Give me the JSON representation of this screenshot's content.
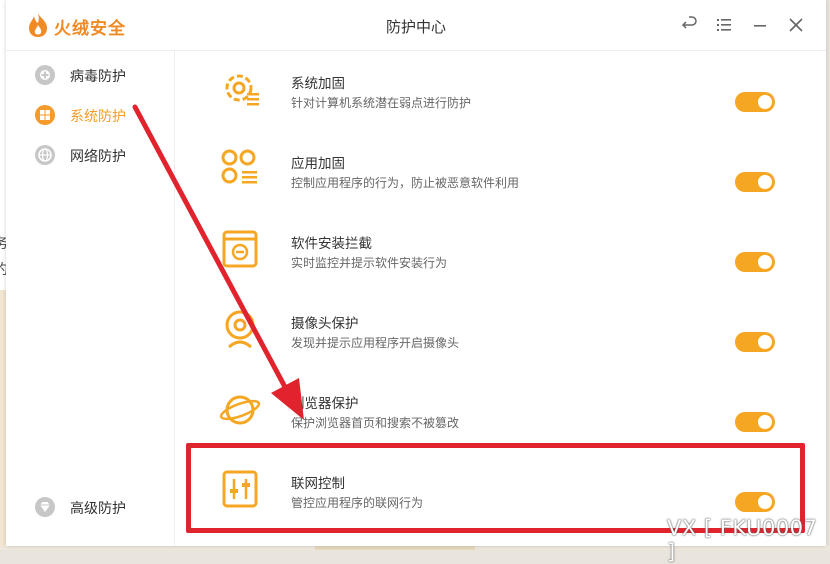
{
  "app": {
    "logo_text": "火绒安全",
    "window_title": "防护中心",
    "accent_color": "#f5a623"
  },
  "titlebar": {
    "buttons": [
      "back-icon",
      "menu-icon",
      "minimize-icon",
      "close-icon"
    ]
  },
  "sidebar": {
    "items": [
      {
        "label": "病毒防护",
        "icon": "virus-shield-icon",
        "active": false
      },
      {
        "label": "系统防护",
        "icon": "windows-icon",
        "active": true
      },
      {
        "label": "网络防护",
        "icon": "globe-icon",
        "active": false
      }
    ],
    "bottom_item": {
      "label": "高级防护",
      "icon": "diamond-icon"
    }
  },
  "features": [
    {
      "title": "系统加固",
      "desc": "针对计算机系统潜在弱点进行防护",
      "enabled": true,
      "icon": "gear-shield-icon"
    },
    {
      "title": "应用加固",
      "desc": "控制应用程序的行为，防止被恶意软件利用",
      "enabled": true,
      "icon": "apps-icon"
    },
    {
      "title": "软件安装拦截",
      "desc": "实时监控并提示软件安装行为",
      "enabled": true,
      "icon": "install-block-icon"
    },
    {
      "title": "摄像头保护",
      "desc": "发现并提示应用程序开启摄像头",
      "enabled": true,
      "icon": "webcam-icon"
    },
    {
      "title": "浏览器保护",
      "desc": "保护浏览器首页和搜索不被篡改",
      "enabled": true,
      "icon": "planet-icon"
    },
    {
      "title": "联网控制",
      "desc": "管控应用程序的联网行为",
      "enabled": true,
      "icon": "sliders-icon"
    }
  ],
  "background_text": [
    "务",
    "约"
  ],
  "watermark": "VX [ FKU0007 ]"
}
